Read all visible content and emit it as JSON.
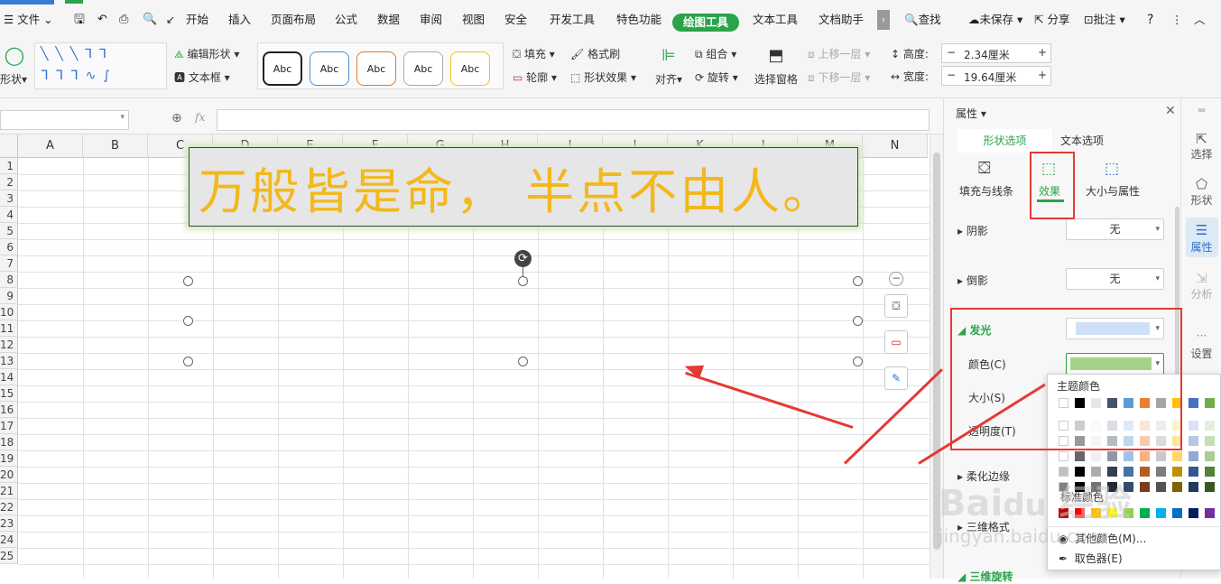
{
  "menu": {
    "file": "文件",
    "items": [
      "开始",
      "插入",
      "页面布局",
      "公式",
      "数据",
      "审阅",
      "视图",
      "安全",
      "开发工具",
      "特色功能",
      "绘图工具",
      "文本工具",
      "文档助手"
    ],
    "active": "绘图工具",
    "search": "查找",
    "unsaved": "未保存",
    "share": "分享",
    "annotate": "批注",
    "help": "?"
  },
  "ribbon": {
    "shape": "形状",
    "edit_shape": "编辑形状",
    "text_box": "文本框",
    "styles": [
      "Abc",
      "Abc",
      "Abc",
      "Abc",
      "Abc"
    ],
    "fill": "填充",
    "format_painter": "格式刷",
    "outline": "轮廓",
    "shape_effect": "形状效果",
    "align": "对齐",
    "group": "组合",
    "rotate": "旋转",
    "select_pane": "选择窗格",
    "bring_forward": "上移一层",
    "send_backward": "下移一层",
    "height_label": "高度:",
    "height_value": "2.34厘米",
    "width_label": "宽度:",
    "width_value": "19.64厘米",
    "minus": "−",
    "plus": "+"
  },
  "formula": {
    "fx": "fx",
    "value": ""
  },
  "columns": [
    "A",
    "B",
    "C",
    "D",
    "E",
    "F",
    "G",
    "H",
    "I",
    "J",
    "K",
    "L",
    "M",
    "N"
  ],
  "rows": [
    "1",
    "2",
    "3",
    "4",
    "5",
    "6",
    "7",
    "8",
    "9",
    "10",
    "11",
    "12",
    "13",
    "14",
    "15",
    "16",
    "17",
    "18",
    "19",
    "20",
    "21",
    "22",
    "23",
    "24",
    "25"
  ],
  "shape_text": "万般皆是命，  半点不由人。",
  "panel": {
    "title": "属性",
    "tabs": [
      "形状选项",
      "文本选项"
    ],
    "subtabs": [
      "填充与线条",
      "效果",
      "大小与属性"
    ],
    "shadow": "阴影",
    "shadow_val": "无",
    "reflection": "倒影",
    "reflection_val": "无",
    "glow": "发光",
    "color": "颜色(C)",
    "size": "大小(S)",
    "transparency": "透明度(T)",
    "soft_edge": "柔化边缘",
    "three_d_format": "三维格式",
    "three_d_rotate": "三维旋转"
  },
  "popup": {
    "theme": "主题颜色",
    "standard": "标准颜色",
    "more": "其他颜色(M)...",
    "picker": "取色器(E)"
  },
  "rightbar": [
    "选择",
    "形状",
    "属性",
    "分析",
    "设置"
  ],
  "colors": {
    "accent": "#2aa34a",
    "red": "#e53935",
    "text": "#f2b81c",
    "glow": "#a5d38a"
  },
  "watermark": "Bai du 经验  jingyan.baidu.com"
}
